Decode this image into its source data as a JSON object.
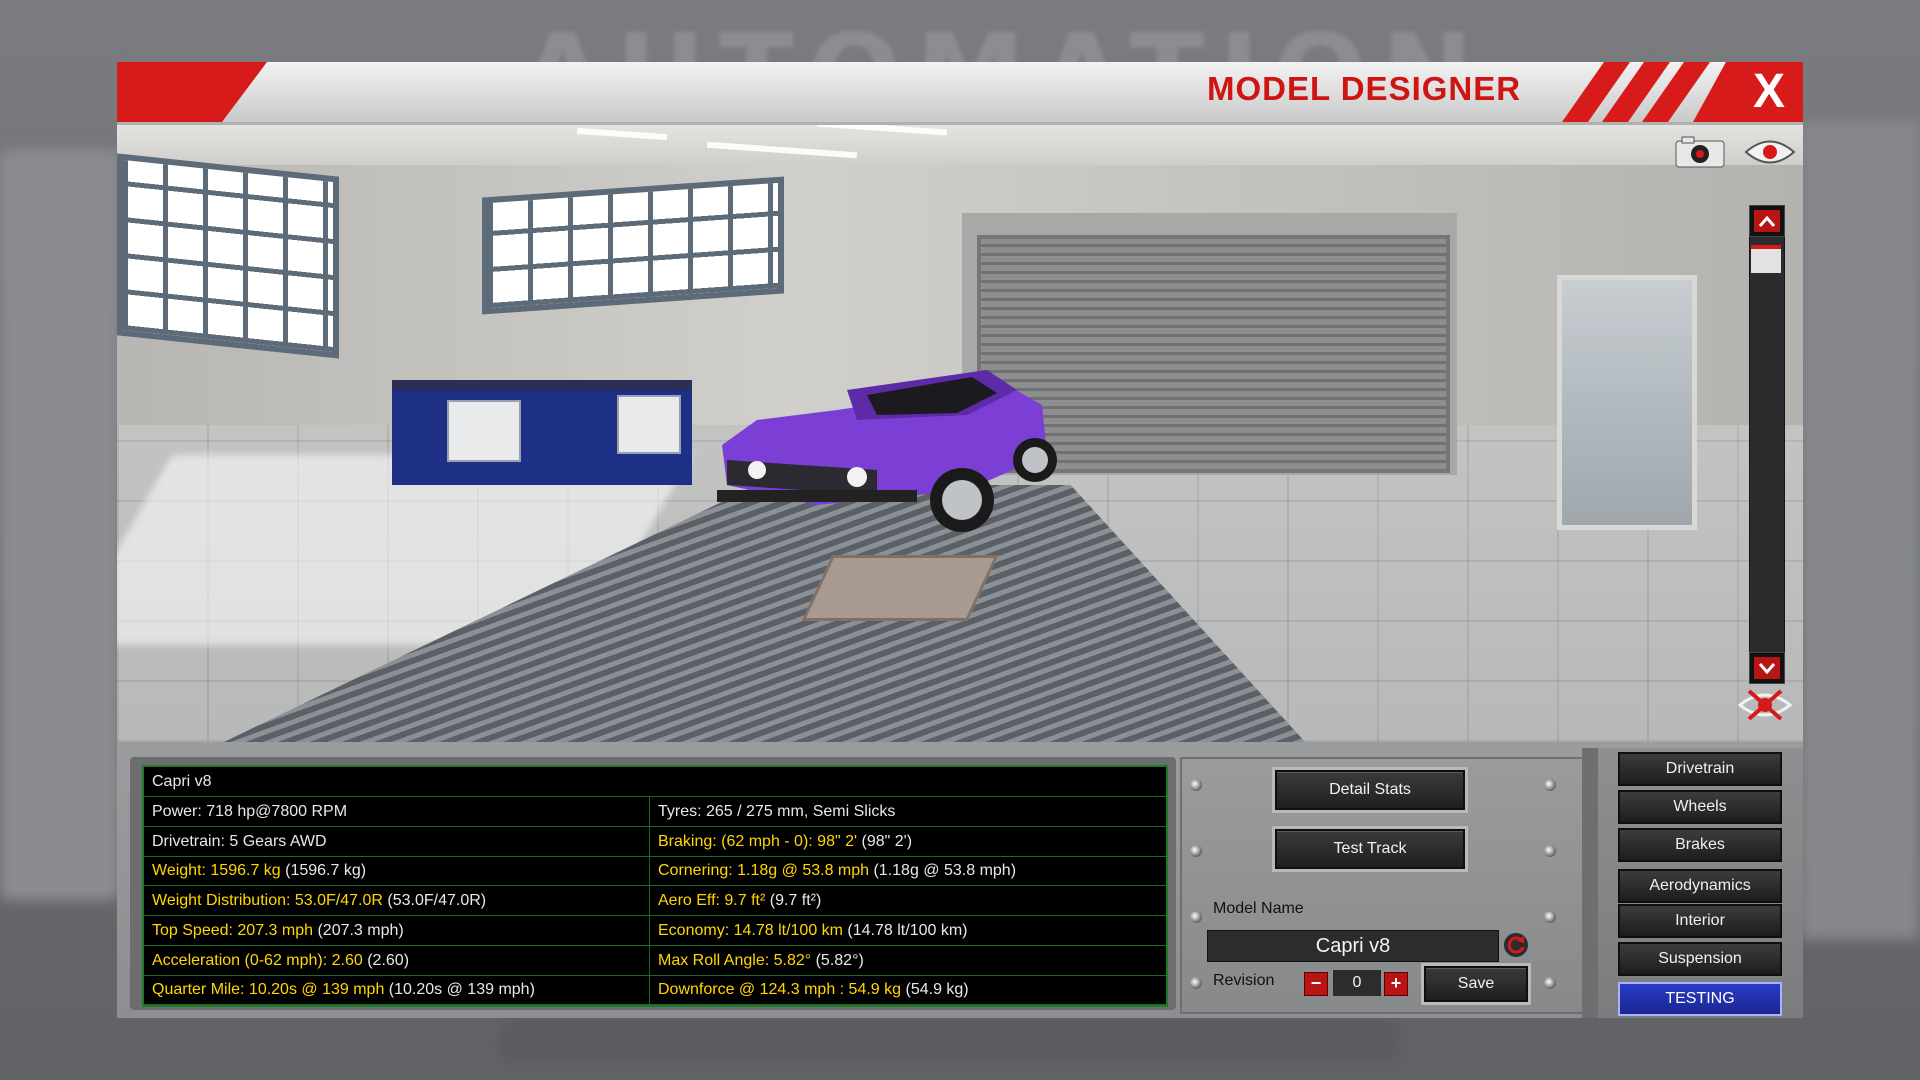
{
  "window": {
    "title": "MODEL DESIGNER",
    "close_label": "X"
  },
  "background": {
    "logo_text": "AUTOMATION"
  },
  "viewport": {
    "toolbar": {
      "camera_icon": "camera-icon",
      "eye_icon": "eye-icon",
      "hide_icon": "hide-ui-icon"
    }
  },
  "stats": {
    "model_name": "Capri v8",
    "left": [
      {
        "label": "Power: 718 hp@7800 RPM",
        "compare": "",
        "highlight": false
      },
      {
        "label": "Drivetrain: 5 Gears AWD",
        "compare": "",
        "highlight": false
      },
      {
        "label": "Weight: 1596.7 kg",
        "compare": " (1596.7 kg)",
        "highlight": true
      },
      {
        "label": "Weight Distribution: 53.0F/47.0R",
        "compare": " (53.0F/47.0R)",
        "highlight": true
      },
      {
        "label": "Top Speed: 207.3 mph",
        "compare": " (207.3 mph)",
        "highlight": true
      },
      {
        "label": "Acceleration (0-62 mph): 2.60",
        "compare": " (2.60)",
        "highlight": true
      },
      {
        "label": "Quarter Mile: 10.20s @ 139 mph",
        "compare": " (10.20s @ 139 mph)",
        "highlight": true
      }
    ],
    "right": [
      {
        "label": "Tyres: 265 / 275 mm, Semi Slicks",
        "compare": "",
        "highlight": false
      },
      {
        "label": "Braking: (62 mph - 0): 98\" 2'",
        "compare": " (98\" 2')",
        "highlight": true
      },
      {
        "label": "Cornering: 1.18g @ 53.8 mph",
        "compare": " (1.18g @ 53.8 mph)",
        "highlight": true
      },
      {
        "label": "Aero Eff: 9.7 ft²",
        "compare": " (9.7 ft²)",
        "highlight": true
      },
      {
        "label": "Economy: 14.78 lt/100 km",
        "compare": " (14.78 lt/100 km)",
        "highlight": true
      },
      {
        "label": "Max Roll Angle: 5.82°",
        "compare": " (5.82°)",
        "highlight": true
      },
      {
        "label": "Downforce @ 124.3 mph : 54.9 kg",
        "compare": " (54.9 kg)",
        "highlight": true
      }
    ]
  },
  "controls": {
    "detail_stats_label": "Detail Stats",
    "test_track_label": "Test Track",
    "model_name_label": "Model Name",
    "model_name_value": "Capri v8",
    "revision_label": "Revision",
    "revision_value": "0",
    "minus_label": "−",
    "plus_label": "+",
    "save_label": "Save"
  },
  "nav": {
    "items": [
      {
        "label": "Drivetrain",
        "active": false
      },
      {
        "label": "Wheels",
        "active": false
      },
      {
        "label": "Brakes",
        "active": false
      },
      {
        "label": "Aerodynamics",
        "active": false
      },
      {
        "label": "Interior",
        "active": false
      },
      {
        "label": "Suspension",
        "active": false
      },
      {
        "label": "TESTING",
        "active": true
      }
    ]
  },
  "colors": {
    "accent_red": "#d71a1a",
    "highlight_yellow": "#ffd700",
    "grid_green": "#1d7a2a",
    "car_purple": "#7b3fd6",
    "active_blue": "#1b278f"
  }
}
